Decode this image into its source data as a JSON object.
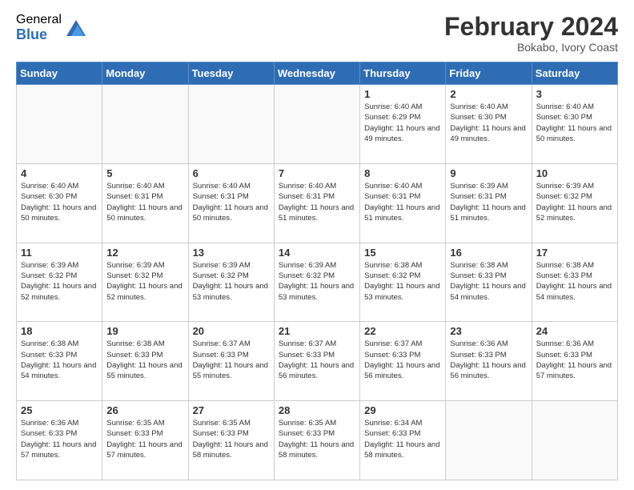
{
  "logo": {
    "general": "General",
    "blue": "Blue"
  },
  "header": {
    "month_year": "February 2024",
    "subtitle": "Bokabo, Ivory Coast"
  },
  "weekdays": [
    "Sunday",
    "Monday",
    "Tuesday",
    "Wednesday",
    "Thursday",
    "Friday",
    "Saturday"
  ],
  "weeks": [
    [
      {
        "day": "",
        "info": ""
      },
      {
        "day": "",
        "info": ""
      },
      {
        "day": "",
        "info": ""
      },
      {
        "day": "",
        "info": ""
      },
      {
        "day": "1",
        "info": "Sunrise: 6:40 AM\nSunset: 6:29 PM\nDaylight: 11 hours and 49 minutes."
      },
      {
        "day": "2",
        "info": "Sunrise: 6:40 AM\nSunset: 6:30 PM\nDaylight: 11 hours and 49 minutes."
      },
      {
        "day": "3",
        "info": "Sunrise: 6:40 AM\nSunset: 6:30 PM\nDaylight: 11 hours and 50 minutes."
      }
    ],
    [
      {
        "day": "4",
        "info": "Sunrise: 6:40 AM\nSunset: 6:30 PM\nDaylight: 11 hours and 50 minutes."
      },
      {
        "day": "5",
        "info": "Sunrise: 6:40 AM\nSunset: 6:31 PM\nDaylight: 11 hours and 50 minutes."
      },
      {
        "day": "6",
        "info": "Sunrise: 6:40 AM\nSunset: 6:31 PM\nDaylight: 11 hours and 50 minutes."
      },
      {
        "day": "7",
        "info": "Sunrise: 6:40 AM\nSunset: 6:31 PM\nDaylight: 11 hours and 51 minutes."
      },
      {
        "day": "8",
        "info": "Sunrise: 6:40 AM\nSunset: 6:31 PM\nDaylight: 11 hours and 51 minutes."
      },
      {
        "day": "9",
        "info": "Sunrise: 6:39 AM\nSunset: 6:31 PM\nDaylight: 11 hours and 51 minutes."
      },
      {
        "day": "10",
        "info": "Sunrise: 6:39 AM\nSunset: 6:32 PM\nDaylight: 11 hours and 52 minutes."
      }
    ],
    [
      {
        "day": "11",
        "info": "Sunrise: 6:39 AM\nSunset: 6:32 PM\nDaylight: 11 hours and 52 minutes."
      },
      {
        "day": "12",
        "info": "Sunrise: 6:39 AM\nSunset: 6:32 PM\nDaylight: 11 hours and 52 minutes."
      },
      {
        "day": "13",
        "info": "Sunrise: 6:39 AM\nSunset: 6:32 PM\nDaylight: 11 hours and 53 minutes."
      },
      {
        "day": "14",
        "info": "Sunrise: 6:39 AM\nSunset: 6:32 PM\nDaylight: 11 hours and 53 minutes."
      },
      {
        "day": "15",
        "info": "Sunrise: 6:38 AM\nSunset: 6:32 PM\nDaylight: 11 hours and 53 minutes."
      },
      {
        "day": "16",
        "info": "Sunrise: 6:38 AM\nSunset: 6:33 PM\nDaylight: 11 hours and 54 minutes."
      },
      {
        "day": "17",
        "info": "Sunrise: 6:38 AM\nSunset: 6:33 PM\nDaylight: 11 hours and 54 minutes."
      }
    ],
    [
      {
        "day": "18",
        "info": "Sunrise: 6:38 AM\nSunset: 6:33 PM\nDaylight: 11 hours and 54 minutes."
      },
      {
        "day": "19",
        "info": "Sunrise: 6:38 AM\nSunset: 6:33 PM\nDaylight: 11 hours and 55 minutes."
      },
      {
        "day": "20",
        "info": "Sunrise: 6:37 AM\nSunset: 6:33 PM\nDaylight: 11 hours and 55 minutes."
      },
      {
        "day": "21",
        "info": "Sunrise: 6:37 AM\nSunset: 6:33 PM\nDaylight: 11 hours and 56 minutes."
      },
      {
        "day": "22",
        "info": "Sunrise: 6:37 AM\nSunset: 6:33 PM\nDaylight: 11 hours and 56 minutes."
      },
      {
        "day": "23",
        "info": "Sunrise: 6:36 AM\nSunset: 6:33 PM\nDaylight: 11 hours and 56 minutes."
      },
      {
        "day": "24",
        "info": "Sunrise: 6:36 AM\nSunset: 6:33 PM\nDaylight: 11 hours and 57 minutes."
      }
    ],
    [
      {
        "day": "25",
        "info": "Sunrise: 6:36 AM\nSunset: 6:33 PM\nDaylight: 11 hours and 57 minutes."
      },
      {
        "day": "26",
        "info": "Sunrise: 6:35 AM\nSunset: 6:33 PM\nDaylight: 11 hours and 57 minutes."
      },
      {
        "day": "27",
        "info": "Sunrise: 6:35 AM\nSunset: 6:33 PM\nDaylight: 11 hours and 58 minutes."
      },
      {
        "day": "28",
        "info": "Sunrise: 6:35 AM\nSunset: 6:33 PM\nDaylight: 11 hours and 58 minutes."
      },
      {
        "day": "29",
        "info": "Sunrise: 6:34 AM\nSunset: 6:33 PM\nDaylight: 11 hours and 58 minutes."
      },
      {
        "day": "",
        "info": ""
      },
      {
        "day": "",
        "info": ""
      }
    ]
  ]
}
